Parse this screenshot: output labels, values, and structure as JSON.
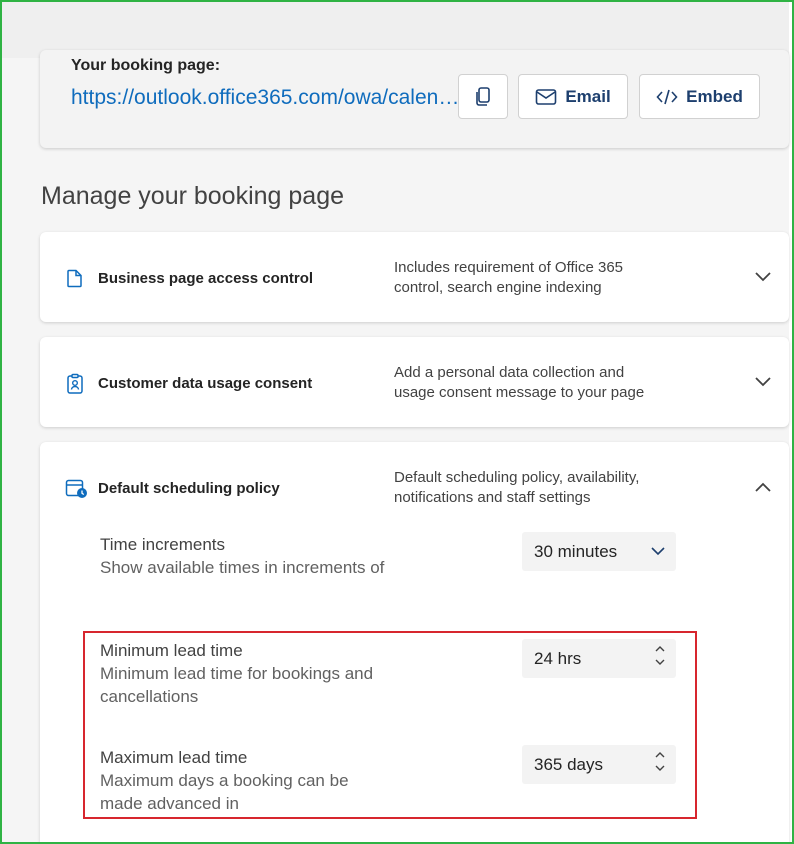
{
  "booking_link": {
    "title": "Your booking page:",
    "url": "https://outlook.office365.com/owa/calendar",
    "copy_icon": "copy-icon",
    "email_label": "Email",
    "embed_label": "Embed"
  },
  "manage": {
    "heading": "Manage your booking page",
    "panels": [
      {
        "icon": "document-icon",
        "title": "Business page access control",
        "desc_line1": "Includes requirement of Office 365",
        "desc_line2": "control, search engine indexing",
        "expanded": false
      },
      {
        "icon": "clipboard-person-icon",
        "title": "Customer data usage consent",
        "desc_line1": "Add a personal data collection and",
        "desc_line2": "usage consent message to your page",
        "expanded": false
      },
      {
        "icon": "calendar-clock-icon",
        "title": "Default scheduling policy",
        "desc_line1": "Default scheduling policy, availability,",
        "desc_line2": "notifications and staff settings",
        "expanded": true
      }
    ]
  },
  "policy": {
    "time_increments": {
      "label": "Time increments",
      "desc": "Show available times in increments of",
      "value": "30 minutes"
    },
    "min_lead": {
      "label": "Minimum lead time",
      "desc_line1": "Minimum lead time for bookings and",
      "desc_line2": "cancellations",
      "value": "24 hrs"
    },
    "max_lead": {
      "label": "Maximum lead time",
      "desc_line1": "Maximum days a booking can be",
      "desc_line2": "made advanced in",
      "value": "365 days"
    }
  },
  "colors": {
    "link": "#0f6cbd",
    "highlight": "#d7262e",
    "frame": "#2fb344"
  }
}
